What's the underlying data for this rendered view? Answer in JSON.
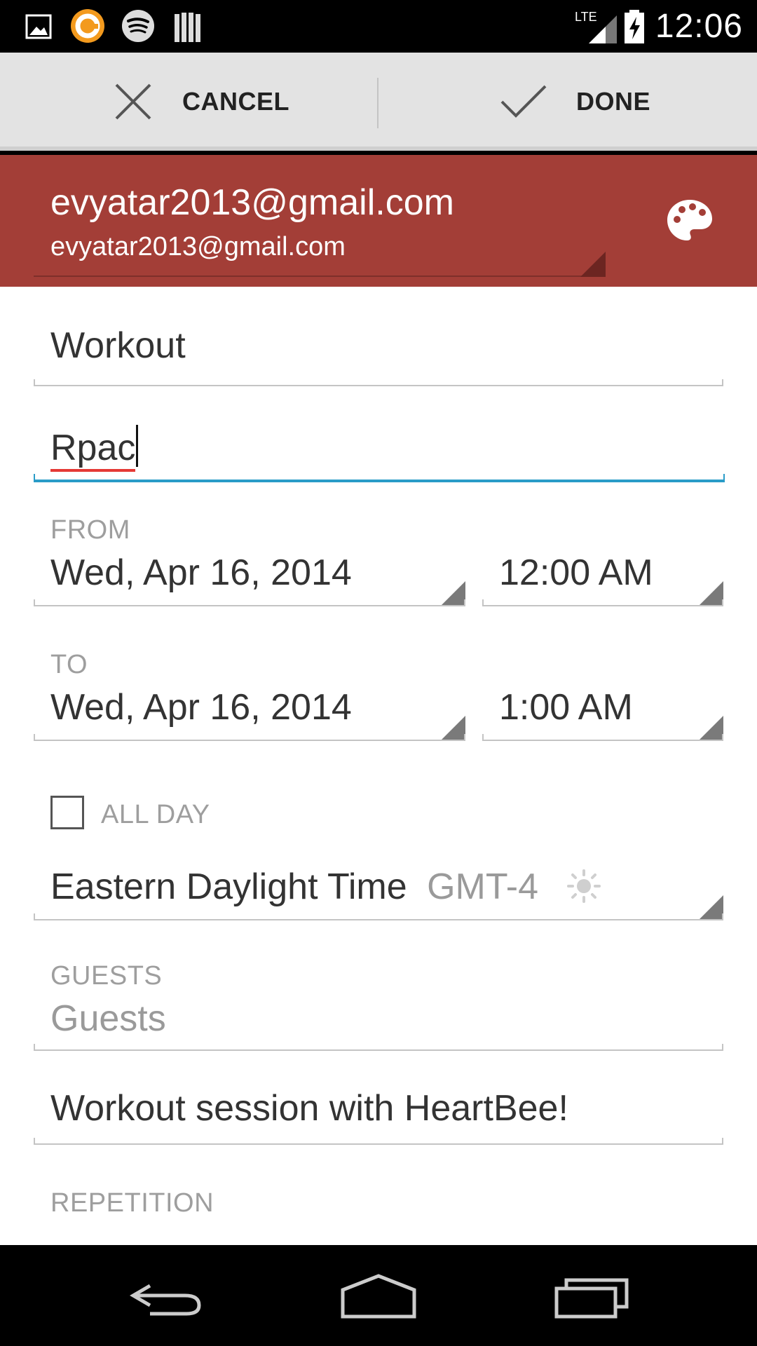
{
  "status_bar": {
    "time": "12:06",
    "network": "LTE",
    "icons": [
      "gallery-icon",
      "orange-circle-app-icon",
      "spotify-icon",
      "books-icon",
      "lte-signal-icon",
      "battery-charging-icon"
    ]
  },
  "action_bar": {
    "cancel_label": "CANCEL",
    "done_label": "DONE",
    "cancel_icon": "close-icon",
    "done_icon": "check-icon"
  },
  "account": {
    "name": "evyatar2013@gmail.com",
    "email": "evyatar2013@gmail.com",
    "color_icon": "palette-icon",
    "color": "#a33e37"
  },
  "form": {
    "title_value": "Workout",
    "location_value": "Rpac",
    "from_label": "FROM",
    "from_date": "Wed, Apr 16, 2014",
    "from_time": "12:00 AM",
    "to_label": "TO",
    "to_date": "Wed, Apr 16, 2014",
    "to_time": "1:00 AM",
    "all_day_label": "ALL DAY",
    "all_day_checked": false,
    "timezone_name": "Eastern Daylight Time",
    "timezone_offset": "GMT-4",
    "guests_label": "GUESTS",
    "guests_placeholder": "Guests",
    "description_value": "Workout session with HeartBee!",
    "repetition_label": "REPETITION"
  },
  "colors": {
    "accent_focus": "#2a9cc8",
    "spellcheck": "#e53935"
  }
}
